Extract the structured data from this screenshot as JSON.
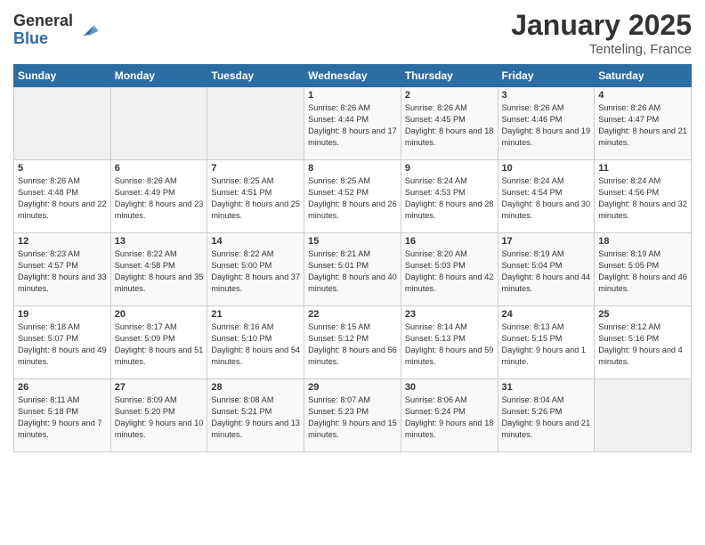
{
  "logo": {
    "general": "General",
    "blue": "Blue"
  },
  "header": {
    "title": "January 2025",
    "subtitle": "Tenteling, France"
  },
  "weekdays": [
    "Sunday",
    "Monday",
    "Tuesday",
    "Wednesday",
    "Thursday",
    "Friday",
    "Saturday"
  ],
  "weeks": [
    [
      {
        "day": "",
        "empty": true
      },
      {
        "day": "",
        "empty": true
      },
      {
        "day": "",
        "empty": true
      },
      {
        "day": "1",
        "sunrise": "Sunrise: 8:26 AM",
        "sunset": "Sunset: 4:44 PM",
        "daylight": "Daylight: 8 hours and 17 minutes."
      },
      {
        "day": "2",
        "sunrise": "Sunrise: 8:26 AM",
        "sunset": "Sunset: 4:45 PM",
        "daylight": "Daylight: 8 hours and 18 minutes."
      },
      {
        "day": "3",
        "sunrise": "Sunrise: 8:26 AM",
        "sunset": "Sunset: 4:46 PM",
        "daylight": "Daylight: 8 hours and 19 minutes."
      },
      {
        "day": "4",
        "sunrise": "Sunrise: 8:26 AM",
        "sunset": "Sunset: 4:47 PM",
        "daylight": "Daylight: 8 hours and 21 minutes."
      }
    ],
    [
      {
        "day": "5",
        "sunrise": "Sunrise: 8:26 AM",
        "sunset": "Sunset: 4:48 PM",
        "daylight": "Daylight: 8 hours and 22 minutes."
      },
      {
        "day": "6",
        "sunrise": "Sunrise: 8:26 AM",
        "sunset": "Sunset: 4:49 PM",
        "daylight": "Daylight: 8 hours and 23 minutes."
      },
      {
        "day": "7",
        "sunrise": "Sunrise: 8:25 AM",
        "sunset": "Sunset: 4:51 PM",
        "daylight": "Daylight: 8 hours and 25 minutes."
      },
      {
        "day": "8",
        "sunrise": "Sunrise: 8:25 AM",
        "sunset": "Sunset: 4:52 PM",
        "daylight": "Daylight: 8 hours and 26 minutes."
      },
      {
        "day": "9",
        "sunrise": "Sunrise: 8:24 AM",
        "sunset": "Sunset: 4:53 PM",
        "daylight": "Daylight: 8 hours and 28 minutes."
      },
      {
        "day": "10",
        "sunrise": "Sunrise: 8:24 AM",
        "sunset": "Sunset: 4:54 PM",
        "daylight": "Daylight: 8 hours and 30 minutes."
      },
      {
        "day": "11",
        "sunrise": "Sunrise: 8:24 AM",
        "sunset": "Sunset: 4:56 PM",
        "daylight": "Daylight: 8 hours and 32 minutes."
      }
    ],
    [
      {
        "day": "12",
        "sunrise": "Sunrise: 8:23 AM",
        "sunset": "Sunset: 4:57 PM",
        "daylight": "Daylight: 8 hours and 33 minutes."
      },
      {
        "day": "13",
        "sunrise": "Sunrise: 8:22 AM",
        "sunset": "Sunset: 4:58 PM",
        "daylight": "Daylight: 8 hours and 35 minutes."
      },
      {
        "day": "14",
        "sunrise": "Sunrise: 8:22 AM",
        "sunset": "Sunset: 5:00 PM",
        "daylight": "Daylight: 8 hours and 37 minutes."
      },
      {
        "day": "15",
        "sunrise": "Sunrise: 8:21 AM",
        "sunset": "Sunset: 5:01 PM",
        "daylight": "Daylight: 8 hours and 40 minutes."
      },
      {
        "day": "16",
        "sunrise": "Sunrise: 8:20 AM",
        "sunset": "Sunset: 5:03 PM",
        "daylight": "Daylight: 8 hours and 42 minutes."
      },
      {
        "day": "17",
        "sunrise": "Sunrise: 8:19 AM",
        "sunset": "Sunset: 5:04 PM",
        "daylight": "Daylight: 8 hours and 44 minutes."
      },
      {
        "day": "18",
        "sunrise": "Sunrise: 8:19 AM",
        "sunset": "Sunset: 5:05 PM",
        "daylight": "Daylight: 8 hours and 46 minutes."
      }
    ],
    [
      {
        "day": "19",
        "sunrise": "Sunrise: 8:18 AM",
        "sunset": "Sunset: 5:07 PM",
        "daylight": "Daylight: 8 hours and 49 minutes."
      },
      {
        "day": "20",
        "sunrise": "Sunrise: 8:17 AM",
        "sunset": "Sunset: 5:09 PM",
        "daylight": "Daylight: 8 hours and 51 minutes."
      },
      {
        "day": "21",
        "sunrise": "Sunrise: 8:16 AM",
        "sunset": "Sunset: 5:10 PM",
        "daylight": "Daylight: 8 hours and 54 minutes."
      },
      {
        "day": "22",
        "sunrise": "Sunrise: 8:15 AM",
        "sunset": "Sunset: 5:12 PM",
        "daylight": "Daylight: 8 hours and 56 minutes."
      },
      {
        "day": "23",
        "sunrise": "Sunrise: 8:14 AM",
        "sunset": "Sunset: 5:13 PM",
        "daylight": "Daylight: 8 hours and 59 minutes."
      },
      {
        "day": "24",
        "sunrise": "Sunrise: 8:13 AM",
        "sunset": "Sunset: 5:15 PM",
        "daylight": "Daylight: 9 hours and 1 minute."
      },
      {
        "day": "25",
        "sunrise": "Sunrise: 8:12 AM",
        "sunset": "Sunset: 5:16 PM",
        "daylight": "Daylight: 9 hours and 4 minutes."
      }
    ],
    [
      {
        "day": "26",
        "sunrise": "Sunrise: 8:11 AM",
        "sunset": "Sunset: 5:18 PM",
        "daylight": "Daylight: 9 hours and 7 minutes."
      },
      {
        "day": "27",
        "sunrise": "Sunrise: 8:09 AM",
        "sunset": "Sunset: 5:20 PM",
        "daylight": "Daylight: 9 hours and 10 minutes."
      },
      {
        "day": "28",
        "sunrise": "Sunrise: 8:08 AM",
        "sunset": "Sunset: 5:21 PM",
        "daylight": "Daylight: 9 hours and 13 minutes."
      },
      {
        "day": "29",
        "sunrise": "Sunrise: 8:07 AM",
        "sunset": "Sunset: 5:23 PM",
        "daylight": "Daylight: 9 hours and 15 minutes."
      },
      {
        "day": "30",
        "sunrise": "Sunrise: 8:06 AM",
        "sunset": "Sunset: 5:24 PM",
        "daylight": "Daylight: 9 hours and 18 minutes."
      },
      {
        "day": "31",
        "sunrise": "Sunrise: 8:04 AM",
        "sunset": "Sunset: 5:26 PM",
        "daylight": "Daylight: 9 hours and 21 minutes."
      },
      {
        "day": "",
        "empty": true
      }
    ]
  ]
}
